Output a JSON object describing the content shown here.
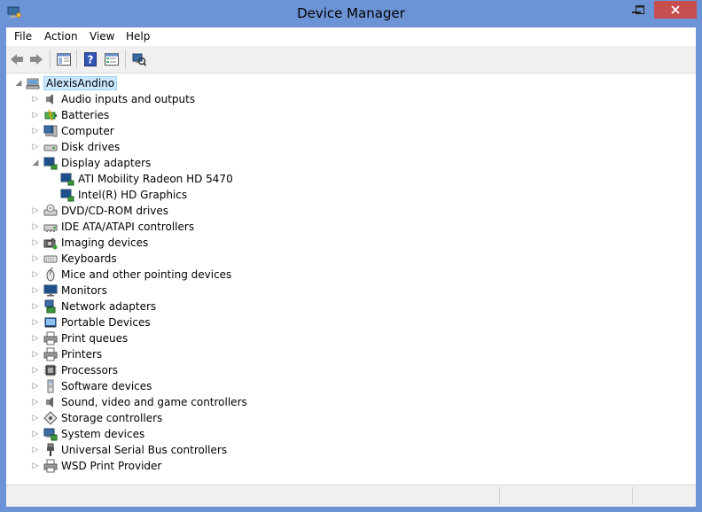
{
  "window": {
    "title": "Device Manager"
  },
  "colors": {
    "frame": "#6b93d6",
    "close": "#c74f50",
    "selection": "#cce8ff"
  },
  "menu": [
    {
      "label": "File"
    },
    {
      "label": "Action"
    },
    {
      "label": "View"
    },
    {
      "label": "Help"
    }
  ],
  "toolbar": [
    {
      "icon": "back-arrow-icon"
    },
    {
      "icon": "forward-arrow-icon"
    },
    {
      "icon": "show-hide-console-tree-icon"
    },
    {
      "icon": "help-icon"
    },
    {
      "icon": "properties-icon"
    },
    {
      "icon": "scan-hardware-icon"
    }
  ],
  "tree": {
    "root": {
      "label": "AlexisAndino",
      "icon": "computer-root-icon"
    },
    "categories": [
      {
        "label": "Audio inputs and outputs",
        "icon": "speaker-icon"
      },
      {
        "label": "Batteries",
        "icon": "battery-icon"
      },
      {
        "label": "Computer",
        "icon": "computer-icon"
      },
      {
        "label": "Disk drives",
        "icon": "disk-drive-icon"
      },
      {
        "label": "Display adapters",
        "icon": "display-adapter-icon",
        "expanded": true,
        "children": [
          {
            "label": "ATI Mobility Radeon HD 5470",
            "icon": "display-adapter-icon"
          },
          {
            "label": "Intel(R) HD Graphics",
            "icon": "display-adapter-icon"
          }
        ]
      },
      {
        "label": "DVD/CD-ROM drives",
        "icon": "dvd-drive-icon"
      },
      {
        "label": "IDE ATA/ATAPI controllers",
        "icon": "ide-controller-icon"
      },
      {
        "label": "Imaging devices",
        "icon": "camera-icon"
      },
      {
        "label": "Keyboards",
        "icon": "keyboard-icon"
      },
      {
        "label": "Mice and other pointing devices",
        "icon": "mouse-icon"
      },
      {
        "label": "Monitors",
        "icon": "monitor-icon"
      },
      {
        "label": "Network adapters",
        "icon": "network-adapter-icon"
      },
      {
        "label": "Portable Devices",
        "icon": "portable-device-icon"
      },
      {
        "label": "Print queues",
        "icon": "printer-icon"
      },
      {
        "label": "Printers",
        "icon": "printer-icon"
      },
      {
        "label": "Processors",
        "icon": "processor-icon"
      },
      {
        "label": "Software devices",
        "icon": "software-device-icon"
      },
      {
        "label": "Sound, video and game controllers",
        "icon": "speaker-icon"
      },
      {
        "label": "Storage controllers",
        "icon": "storage-controller-icon"
      },
      {
        "label": "System devices",
        "icon": "system-device-icon"
      },
      {
        "label": "Universal Serial Bus controllers",
        "icon": "usb-icon"
      },
      {
        "label": "WSD Print Provider",
        "icon": "printer-icon"
      }
    ]
  }
}
